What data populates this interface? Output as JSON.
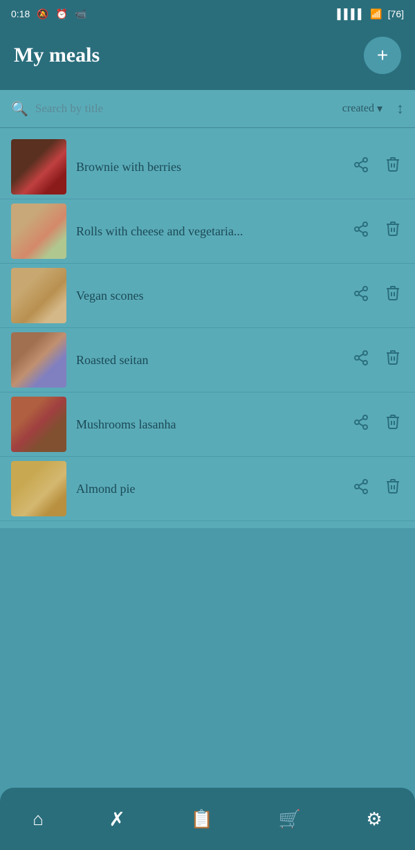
{
  "statusBar": {
    "time": "0:18",
    "batteryLevel": "76"
  },
  "header": {
    "title": "My meals",
    "addButton": "+"
  },
  "searchBar": {
    "placeholder": "Search by title",
    "sortLabel": "created",
    "sortChevron": "▾",
    "sortToggle": "↕"
  },
  "meals": [
    {
      "id": 1,
      "name": "Brownie with berries",
      "thumbClass": "thumb-brownie"
    },
    {
      "id": 2,
      "name": "Rolls with cheese and vegetaria...",
      "thumbClass": "thumb-rolls"
    },
    {
      "id": 3,
      "name": "Vegan scones",
      "thumbClass": "thumb-scones"
    },
    {
      "id": 4,
      "name": "Roasted seitan",
      "thumbClass": "thumb-seitan"
    },
    {
      "id": 5,
      "name": "Mushrooms lasanha",
      "thumbClass": "thumb-lasanha"
    },
    {
      "id": 6,
      "name": "Almond pie",
      "thumbClass": "thumb-almond"
    }
  ],
  "bottomNav": [
    {
      "id": "home",
      "icon": "⌂",
      "label": "home"
    },
    {
      "id": "recipes",
      "icon": "✂",
      "label": "recipes"
    },
    {
      "id": "list",
      "icon": "☰",
      "label": "list"
    },
    {
      "id": "cart",
      "icon": "⛌",
      "label": "cart"
    },
    {
      "id": "settings",
      "icon": "⚙",
      "label": "settings"
    }
  ],
  "colors": {
    "headerBg": "#2a6e7c",
    "bodyBg": "#4a9aaa",
    "listBg": "#5aabb8",
    "accent": "#2a6e7c"
  }
}
